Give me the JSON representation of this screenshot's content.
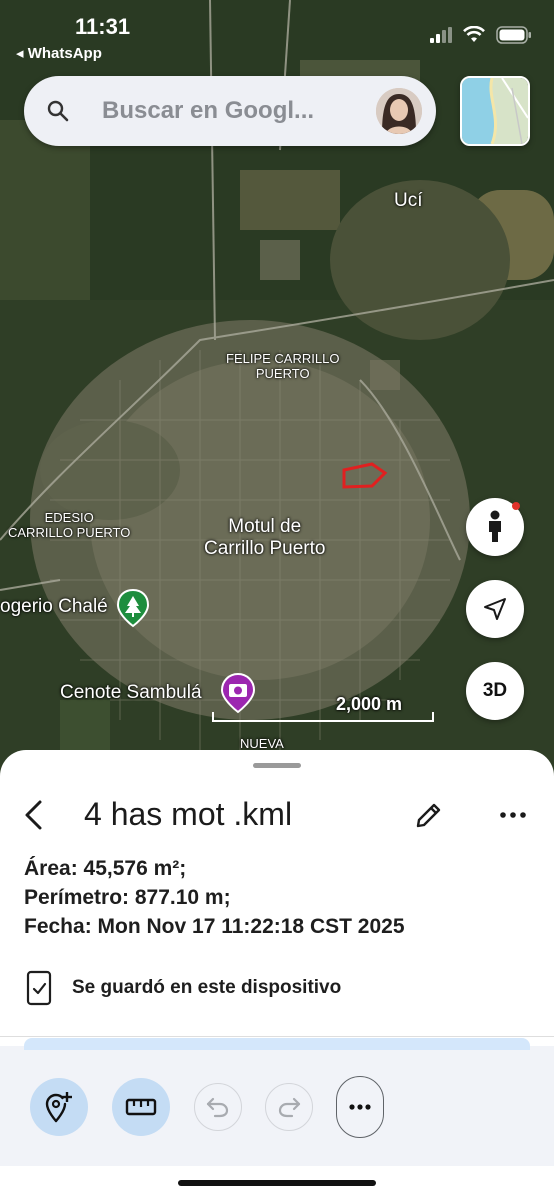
{
  "status_bar": {
    "time": "11:31",
    "back_app": "◂ WhatsApp"
  },
  "search": {
    "placeholder": "Buscar en Googl..."
  },
  "map": {
    "labels": {
      "uci": "Ucí",
      "felipe": "FELIPE CARRILLO\nPUERTO",
      "edesio": "EDESIO\nCARRILLO PUERTO",
      "motul": "Motul de\nCarrillo Puerto",
      "parque": "ogerio Chalé",
      "cenote": "Cenote Sambulá",
      "nueva": "NUEVA"
    },
    "scale": "2,000 m",
    "buttons": {
      "three_d": "3D"
    }
  },
  "sheet": {
    "title": "4 has mot .kml",
    "area": "Área: 45,576 m²;",
    "perimeter": "Perímetro: 877.10 m;",
    "date": "Fecha: Mon Nov 17 11:22:18 CST 2025",
    "saved": "Se guardó en este dispositivo"
  },
  "colors": {
    "accent": "#c4dcf4",
    "polygon": "#e02020",
    "park_pin": "#1e8e3e",
    "photo_pin": "#9c27b0"
  }
}
